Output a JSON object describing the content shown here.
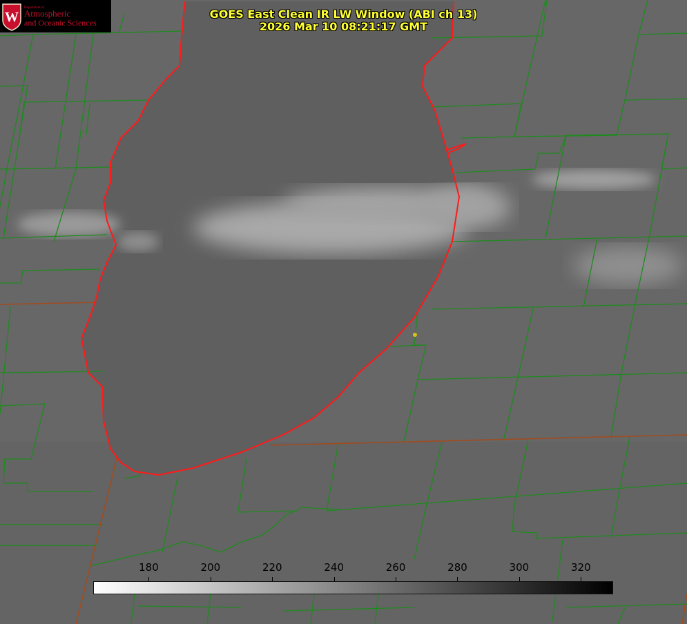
{
  "logo": {
    "small": "Department of",
    "line1": "Atmospheric",
    "line2": "and Oceanic Sciences",
    "color": "#c8102e"
  },
  "title": {
    "line1": "GOES East Clean IR LW Window (ABI ch 13)",
    "line2": "2026 Mar 10 08:21:17 GMT",
    "color": "#ffff33"
  },
  "colorbar": {
    "ticks": [
      180,
      200,
      220,
      240,
      260,
      280,
      300,
      320
    ],
    "min": 162,
    "max": 330,
    "colormap": "white-to-black"
  },
  "colors": {
    "county_lines": "#1f8a1f",
    "lake_shore": "#ff1a1a",
    "background": "#6b6b6b",
    "cloud": "#b8b8b8",
    "marker": "#d4c21a"
  }
}
